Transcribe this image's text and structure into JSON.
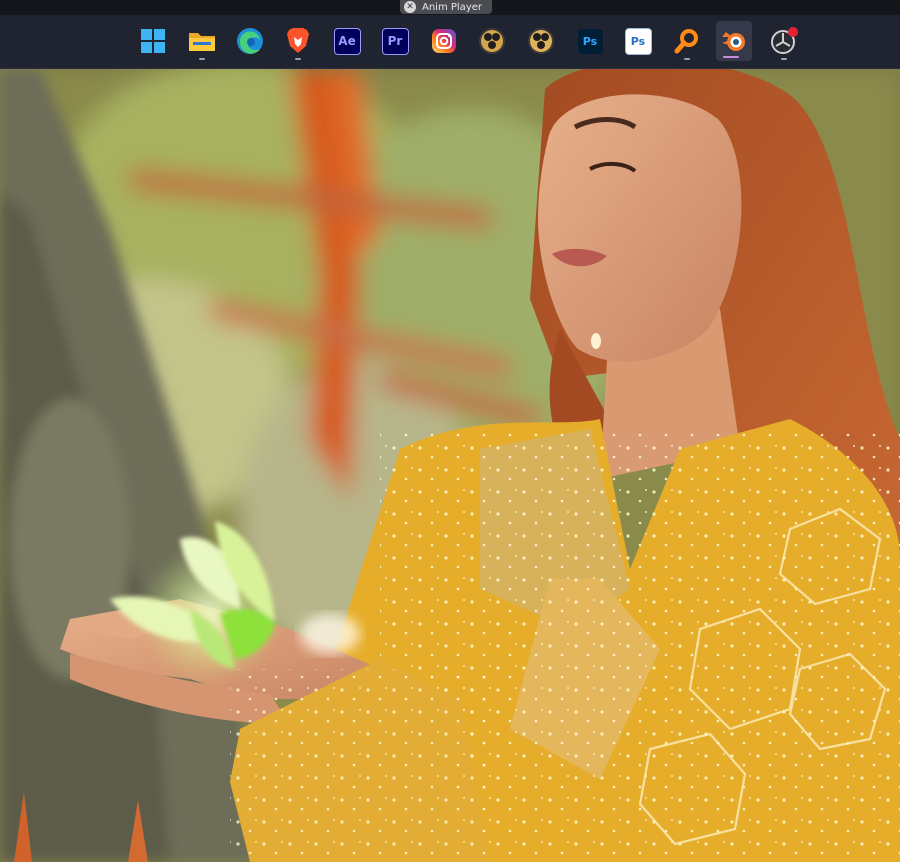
{
  "window": {
    "title": "Anim Player"
  },
  "taskbar": {
    "apps": [
      {
        "name": "Windows Start",
        "icon": "windows-start-icon"
      },
      {
        "name": "File Explorer",
        "icon": "folder-icon"
      },
      {
        "name": "Microsoft Edge",
        "icon": "edge-icon"
      },
      {
        "name": "Brave",
        "icon": "brave-lion-icon"
      },
      {
        "name": "After Effects",
        "icon": "ae-icon",
        "text": "Ae"
      },
      {
        "name": "Premiere Pro",
        "icon": "pr-icon",
        "text": "Pr"
      },
      {
        "name": "Instagram",
        "icon": "instagram-icon"
      },
      {
        "name": "DaVinci Resolve",
        "icon": "davinci-icon"
      },
      {
        "name": "DaVinci Resolve 2",
        "icon": "davinci-icon"
      },
      {
        "name": "Photoshop",
        "icon": "ps-icon",
        "text": "Ps"
      },
      {
        "name": "Photoshop Alt",
        "icon": "ps-alt-icon",
        "text": "Ps"
      },
      {
        "name": "Search Everything",
        "icon": "magnifier-icon"
      },
      {
        "name": "Blender",
        "icon": "blender-icon"
      },
      {
        "name": "Anim Player",
        "icon": "anim-player-icon"
      }
    ]
  },
  "colors": {
    "taskbar_bg": "#202330",
    "accent": "#c58de0",
    "notification": "#e52232"
  }
}
